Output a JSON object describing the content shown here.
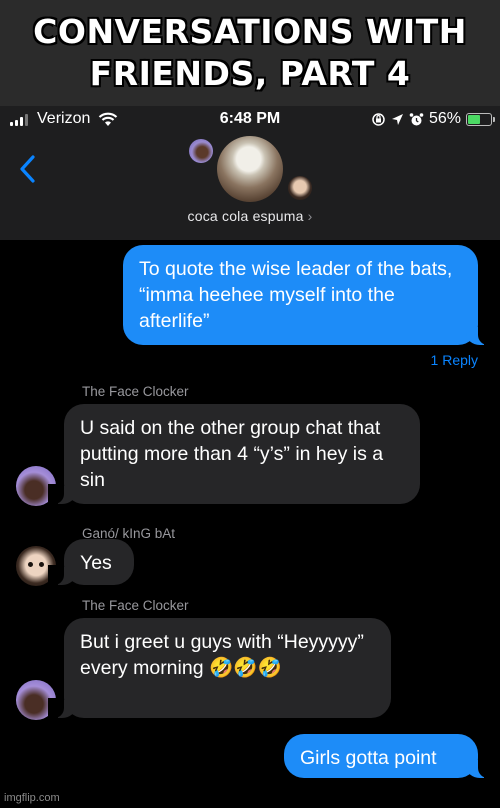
{
  "meme_title": "CONVERSATIONS WITH FRIENDS, PART 4",
  "status_bar": {
    "carrier": "Verizon",
    "time": "6:48 PM",
    "battery_percent": "56%",
    "battery_level": 0.56,
    "icons": [
      "signal-icon",
      "wifi-icon",
      "orientation-lock-icon",
      "location-icon",
      "alarm-icon",
      "battery-charging-icon"
    ]
  },
  "chat": {
    "name": "coca cola espuma",
    "name_chevron": "›"
  },
  "messages": [
    {
      "type": "sent",
      "text": "To quote the wise leader of the bats, “imma heehee myself into the afterlife”",
      "reply_link": "1 Reply"
    },
    {
      "type": "received",
      "sender": "The Face Clocker",
      "text": "U said on the other group chat that putting more than 4 “y’s” in hey is a sin"
    },
    {
      "type": "received",
      "sender": "Ganó/ kInG bAt",
      "text": "Yes"
    },
    {
      "type": "received",
      "sender": "The Face Clocker",
      "text": "But i greet u guys with “Heyyyyy” every morning 🤣🤣🤣"
    },
    {
      "type": "sent",
      "text": "Girls gotta point"
    }
  ],
  "watermark": "imgflip.com",
  "colors": {
    "sent_bubble": "#1d8cf8",
    "received_bubble": "#262628",
    "link": "#0a84ff",
    "battery_fill": "#4cd964"
  }
}
